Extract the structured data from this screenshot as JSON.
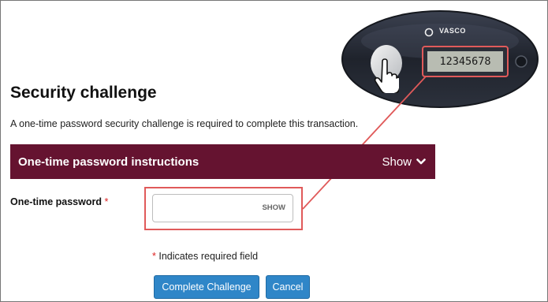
{
  "page": {
    "title": "Security challenge",
    "intro": "A one-time password security challenge is required to complete this transaction."
  },
  "instructions": {
    "title": "One-time password instructions",
    "toggle_label": "Show"
  },
  "otp_field": {
    "label": "One-time password",
    "required_mark": "*",
    "value": "",
    "placeholder": "",
    "show_label": "SHOW"
  },
  "required_note": {
    "mark": "*",
    "text": " Indicates required field"
  },
  "buttons": {
    "complete": "Complete Challenge",
    "cancel": "Cancel"
  },
  "token": {
    "brand": "VASCO",
    "display_code": "12345678"
  },
  "colors": {
    "instructions_bar": "#651330",
    "button_primary": "#2f86c8",
    "required": "#dd2222",
    "callout": "#e05a5a"
  },
  "icons": {
    "toggle": "chevron-down-icon",
    "pointer": "hand-pointer-icon"
  }
}
